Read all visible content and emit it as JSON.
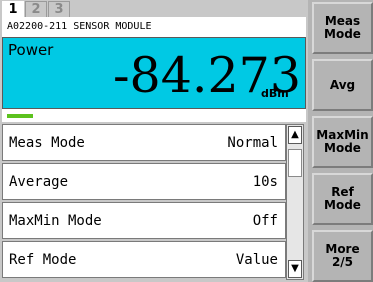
{
  "tabs": [
    "1",
    "2",
    "3"
  ],
  "module_title": "A02200-211 SENSOR MODULE",
  "measurement": {
    "label": "Power",
    "value": "-84.273",
    "unit": "dBm",
    "level_fraction": 0.09,
    "panel_color": "#00c9e4",
    "level_color": "#5cc21e"
  },
  "settings": [
    {
      "label": "Meas Mode",
      "value": "Normal"
    },
    {
      "label": "Average",
      "value": "10s"
    },
    {
      "label": "MaxMin Mode",
      "value": "Off"
    },
    {
      "label": "Ref Mode",
      "value": "Value"
    }
  ],
  "scrollbar": {
    "up_icon": "up-arrow-icon",
    "down_icon": "down-arrow-icon",
    "up_glyph": "▲",
    "down_glyph": "▼"
  },
  "softkeys": [
    {
      "label": "Meas\nMode"
    },
    {
      "label": "Avg"
    },
    {
      "label": "MaxMin\nMode"
    },
    {
      "label": "Ref\nMode"
    },
    {
      "label": "More\n2/5"
    }
  ]
}
